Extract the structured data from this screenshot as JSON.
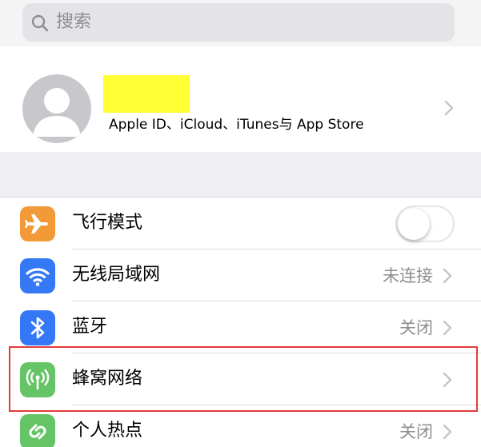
{
  "search": {
    "placeholder": "搜索"
  },
  "profile": {
    "subtitle": "Apple ID、iCloud、iTunes与 App Store"
  },
  "settings": {
    "items": [
      {
        "label": "飞行模式",
        "value": "",
        "icon": "airplane-icon",
        "color": "#f19a37",
        "control": "toggle",
        "toggle_on": false
      },
      {
        "label": "无线局域网",
        "value": "未连接",
        "icon": "wifi-icon",
        "color": "#3478f6",
        "control": "chevron"
      },
      {
        "label": "蓝牙",
        "value": "关闭",
        "icon": "bluetooth-icon",
        "color": "#3478f6",
        "control": "chevron"
      },
      {
        "label": "蜂窝网络",
        "value": "",
        "icon": "cellular-antenna-icon",
        "color": "#65c466",
        "control": "chevron",
        "highlighted": true
      },
      {
        "label": "个人热点",
        "value": "关闭",
        "icon": "hotspot-link-icon",
        "color": "#65c466",
        "control": "chevron"
      }
    ]
  },
  "colors": {
    "highlight_border": "#e23a3a",
    "name_redaction": "#ffff33"
  }
}
